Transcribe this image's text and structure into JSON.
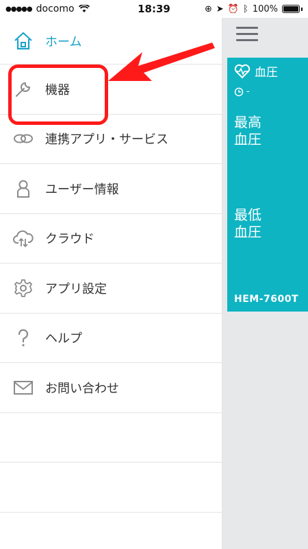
{
  "status_bar": {
    "carrier": "docomo",
    "time": "18:39",
    "battery": "100%"
  },
  "menu": {
    "items": [
      {
        "label": "ホーム",
        "icon": "home-icon"
      },
      {
        "label": "機器",
        "icon": "wrench-icon"
      },
      {
        "label": "連携アプリ・サービス",
        "icon": "link-icon"
      },
      {
        "label": "ユーザー情報",
        "icon": "user-icon"
      },
      {
        "label": "クラウド",
        "icon": "cloud-sync-icon"
      },
      {
        "label": "アプリ設定",
        "icon": "gear-icon"
      },
      {
        "label": "ヘルプ",
        "icon": "question-icon"
      },
      {
        "label": "お問い合わせ",
        "icon": "mail-icon"
      }
    ]
  },
  "card": {
    "title": "血圧",
    "time": "-",
    "systolic_label": "最高\n血圧",
    "diastolic_label": "最低\n血圧",
    "model": "HEM-7600T"
  },
  "colors": {
    "accent": "#1aa3c7",
    "card": "#0fb4c3",
    "highlight": "#ff1a1a"
  }
}
